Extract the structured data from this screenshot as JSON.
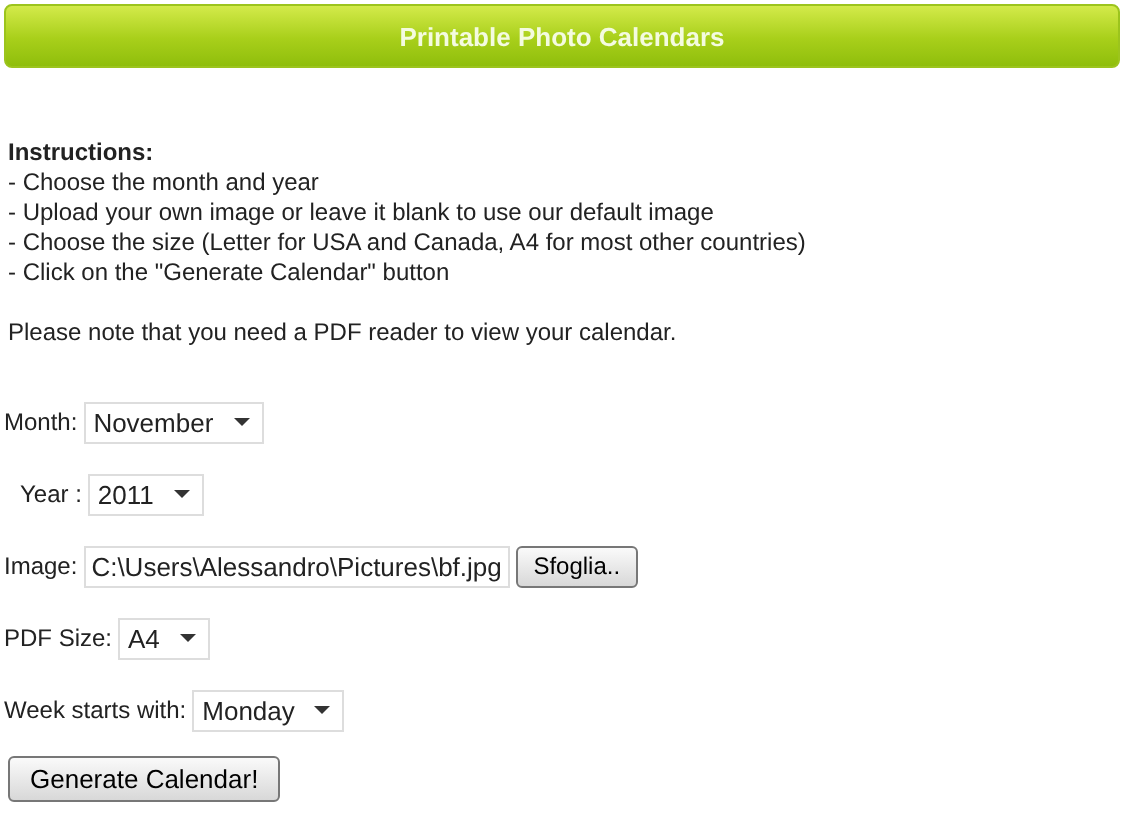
{
  "header": {
    "title": "Printable Photo Calendars"
  },
  "instructions": {
    "heading": "Instructions:",
    "steps": [
      "- Choose the month and year",
      "- Upload your own image or leave it blank to use our default image",
      "- Choose the size (Letter for USA and Canada, A4 for most other countries)",
      "- Click on the \"Generate Calendar\" button"
    ],
    "note": "Please note that you need a PDF reader to view your calendar."
  },
  "fields": [
    {
      "kind": "select",
      "label": "Month:",
      "value": "November"
    },
    {
      "kind": "select",
      "label": "Year :",
      "value": "2011"
    },
    {
      "kind": "file",
      "label": "Image:",
      "value": "C:\\Users\\Alessandro\\Pictures\\bf.jpg",
      "button": "Sfoglia.."
    },
    {
      "kind": "select",
      "label": "PDF Size:",
      "value": "A4"
    },
    {
      "kind": "select",
      "label": "Week starts with:",
      "value": "Monday"
    }
  ],
  "submit": "Generate Calendar!"
}
